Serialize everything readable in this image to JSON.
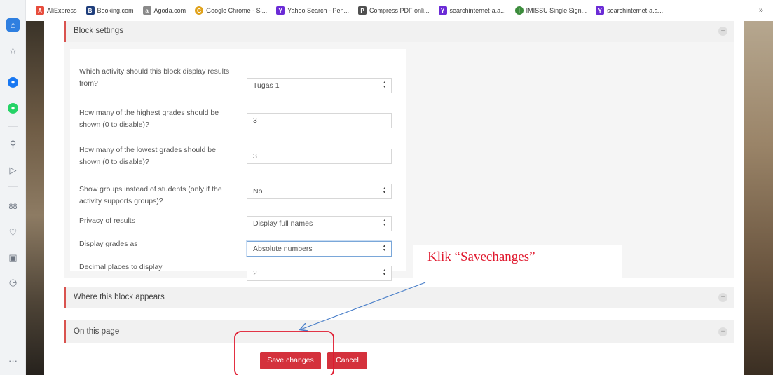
{
  "bookmarks": [
    {
      "label": "AliExpress",
      "color": "#e74c3c",
      "glyph": "A"
    },
    {
      "label": "Booking.com",
      "color": "#1f3e7c",
      "glyph": "B"
    },
    {
      "label": "Agoda.com",
      "color": "#8a8a8a",
      "glyph": "a"
    },
    {
      "label": "Google Chrome - Si...",
      "color": "#e0a21b",
      "glyph": "G"
    },
    {
      "label": "Yahoo Search - Pen...",
      "color": "#6b2bd6",
      "glyph": "Y"
    },
    {
      "label": "Compress PDF onli...",
      "color": "#505050",
      "glyph": "P"
    },
    {
      "label": "searchinternet-a.a...",
      "color": "#6b2bd6",
      "glyph": "Y"
    },
    {
      "label": "IMISSU Single Sign...",
      "color": "#3c8c3c",
      "glyph": "I"
    },
    {
      "label": "searchinternet-a.a...",
      "color": "#6b2bd6",
      "glyph": "Y"
    }
  ],
  "bookmarks_more": "»",
  "sidebar_icons": {
    "home": "⌂",
    "star": "☆",
    "messenger": "●",
    "whatsapp": "●",
    "search": "⚲",
    "send": "▷",
    "grid": "88",
    "heart": "♡",
    "wallet": "▣",
    "clock": "◷",
    "more": "···"
  },
  "section_block_settings": {
    "title": "Block settings",
    "toggle": "−"
  },
  "form": {
    "activity": {
      "label": "Which activity should this block display results from?",
      "value": "Tugas 1"
    },
    "highest": {
      "label": "How many of the highest grades should be shown (0 to disable)?",
      "value": "3"
    },
    "lowest": {
      "label": "How many of the lowest grades should be shown (0 to disable)?",
      "value": "3"
    },
    "groups": {
      "label": "Show groups instead of students (only if the activity supports groups)?",
      "value": "No"
    },
    "privacy": {
      "label": "Privacy of results",
      "value": "Display full names"
    },
    "grades_as": {
      "label": "Display grades as",
      "value": "Absolute numbers"
    },
    "decimals": {
      "label": "Decimal places to display",
      "value": "2"
    }
  },
  "section_where": {
    "title": "Where this block appears",
    "toggle": "+"
  },
  "section_onpage": {
    "title": "On this page",
    "toggle": "+"
  },
  "buttons": {
    "save": "Save changes",
    "cancel": "Cancel"
  },
  "annotation": {
    "text": "Klik “Savechanges”",
    "color": "#e0192e",
    "arrow_color": "#4a7fc9"
  },
  "colors": {
    "accent": "#d4313c",
    "section_border": "#d9534f"
  }
}
